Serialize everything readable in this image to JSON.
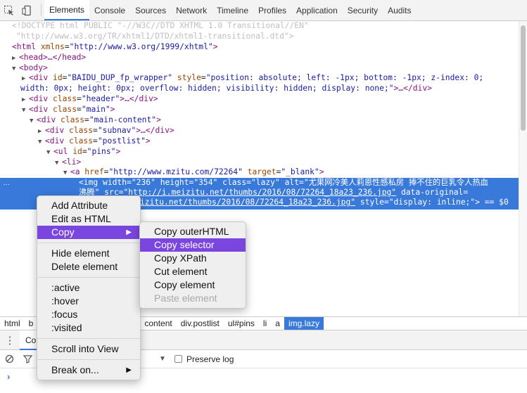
{
  "toolbar": {
    "tabs": [
      "Elements",
      "Console",
      "Sources",
      "Network",
      "Timeline",
      "Profiles",
      "Application",
      "Security",
      "Audits"
    ],
    "active_tab": "Elements"
  },
  "dom": {
    "doctype_1": "<!DOCTYPE html PUBLIC \"-//W3C//DTD XHTML 1.0 Transitional//EN\"",
    "doctype_2": "\"http://www.w3.org/TR/xhtml1/DTD/xhtml1-transitional.dtd\">",
    "html_open": "<html",
    "html_xmlns_name": "xmlns",
    "html_xmlns_val": "\"http://www.w3.org/1999/xhtml\"",
    "head": "<head>…</head>",
    "body_open": "<body>",
    "wrapper_1a": "<div",
    "wrapper_id_name": "id",
    "wrapper_id_val": "\"BAIDU_DUP_fp_wrapper\"",
    "wrapper_style_name": "style",
    "wrapper_style_val_1": "\"position: absolute; left: -1px; bottom: -1px; z-index: 0;",
    "wrapper_style_val_2": "width: 0px; height: 0px; overflow: hidden; visibility: hidden; display: none;\"",
    "wrapper_close": ">…</div>",
    "header_div": "\"header\"",
    "main_div": "\"main\"",
    "main_content_div": "\"main-content\"",
    "subnav_div": "\"subnav\"",
    "postlist_div": "\"postlist\"",
    "pins_ul": "\"pins\"",
    "li": "<li>",
    "a_href": "\"http://www.mzitu.com/72264\"",
    "a_target": "\"_blank\"",
    "img_width": "\"236\"",
    "img_height": "\"354\"",
    "img_class": "\"lazy\"",
    "img_alt_1": "\"尤果网冷美人莉恩性感私房 捧不住的巨乳令人热血",
    "img_alt_2": "沸腾\"",
    "img_src": "\"http://i.meizitu.net/thumbs/2016/08/72264_18a23_236.jpg\"",
    "img_data_original_name": "data-original=",
    "img_data_original_val": "izitu.net/thumbs/2016/08/72264_18a23_236.jpg\"",
    "img_style": "\"display: inline;\"",
    "img_tail": "> == $0",
    "ellipsis": "…"
  },
  "breadcrumbs": [
    "html",
    "b",
    "content",
    "div.postlist",
    "ul#pins",
    "li",
    "a",
    "img.lazy"
  ],
  "drawer": {
    "tab_label": "Co",
    "preserve_log_label": "Preserve log",
    "prompt": "›"
  },
  "context_menu": {
    "items": [
      "Add Attribute",
      "Edit as HTML",
      "Copy",
      "Hide element",
      "Delete element",
      ":active",
      ":hover",
      ":focus",
      ":visited",
      "Scroll into View",
      "Break on..."
    ],
    "highlighted": "Copy"
  },
  "copy_submenu": {
    "items": [
      "Copy outerHTML",
      "Copy selector",
      "Copy XPath",
      "Cut element",
      "Copy element",
      "Paste element"
    ],
    "highlighted": "Copy selector",
    "disabled": "Paste element"
  },
  "colors": {
    "selection": "#3879d9",
    "menu_highlight": "#7b46e0",
    "tag": "#881280",
    "attr_name": "#994500",
    "attr_value": "#1a1aa6"
  }
}
